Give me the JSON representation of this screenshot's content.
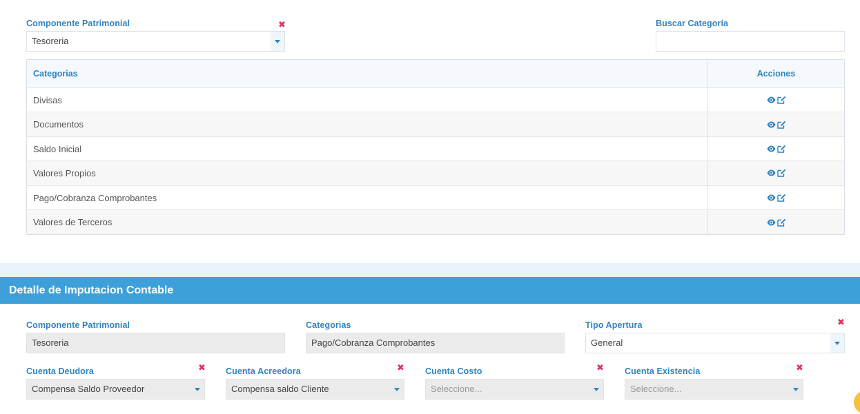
{
  "filter": {
    "componente_label": "Componente Patrimonial",
    "componente_value": "Tesoreria",
    "buscar_label": "Buscar Categoría",
    "buscar_value": ""
  },
  "table": {
    "headers": {
      "categorias": "Categorias",
      "acciones": "Acciones"
    },
    "rows": [
      "Divisas",
      "Documentos",
      "Saldo Inicial",
      "Valores Propios",
      "Pago/Cobranza Comprobantes",
      "Valores de Terceros"
    ],
    "action_icons": [
      "eye-icon",
      "edit-icon"
    ]
  },
  "detail": {
    "title": "Detalle de Imputacion Contable",
    "componente_label": "Componente Patrimonial",
    "componente_value": "Tesoreria",
    "categorias_label": "Categorias",
    "categorias_value": "Pago/Cobranza Comprobantes",
    "tipo_label": "Tipo Apertura",
    "tipo_value": "General",
    "deudora_label": "Cuenta Deudora",
    "deudora_value": "Compensa Saldo Proveedor",
    "acreedora_label": "Cuenta Acreedora",
    "acreedora_value": "Compensa saldo Cliente",
    "costo_label": "Cuenta Costo",
    "costo_placeholder": "Seleccione...",
    "existencia_label": "Cuenta Existencia",
    "existencia_placeholder": "Seleccione..."
  },
  "colors": {
    "accent": "#2f83c0",
    "header_bar": "#3ea0db",
    "clear_mark": "#e0325f"
  }
}
